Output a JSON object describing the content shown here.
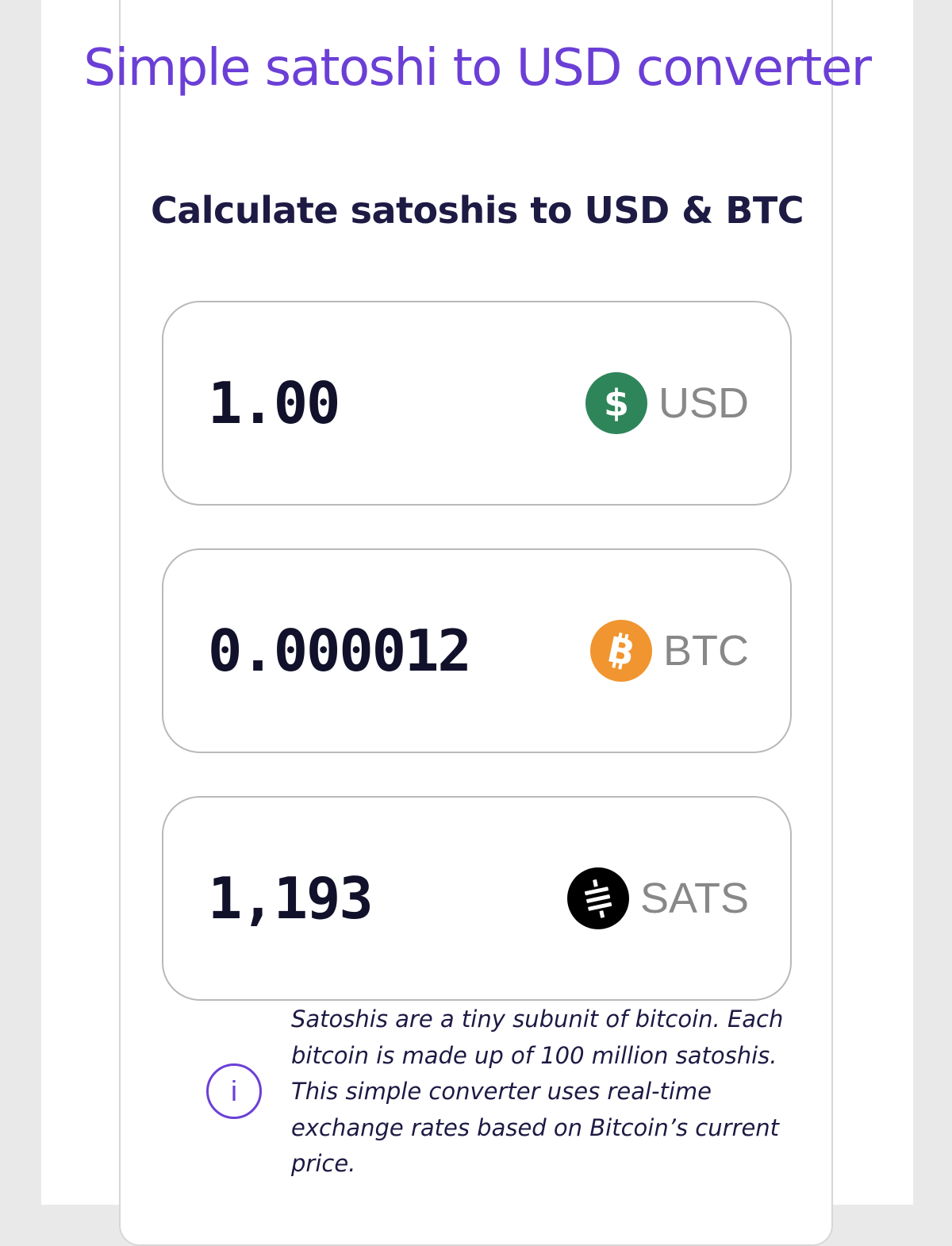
{
  "header": {
    "title": "Simple satoshi to USD converter",
    "subtitle": "Calculate satoshis to USD & BTC"
  },
  "fields": [
    {
      "value": "1.00",
      "currency": "USD",
      "icon": "dollar-icon",
      "icon_color": "#2f855a"
    },
    {
      "value": "0.000012",
      "currency": "BTC",
      "icon": "bitcoin-icon",
      "icon_color": "#f0952f"
    },
    {
      "value": "1,193",
      "currency": "SATS",
      "icon": "sats-icon",
      "icon_color": "#000000"
    }
  ],
  "info": {
    "icon": "info-icon",
    "text": "Satoshis are a tiny subunit of bitcoin. Each bitcoin is made up of 100 million satoshis. This simple converter uses real-time exchange rates based on Bitcoin’s current price."
  },
  "colors": {
    "accent": "#6b3fd6",
    "text": "#1d1a44"
  }
}
